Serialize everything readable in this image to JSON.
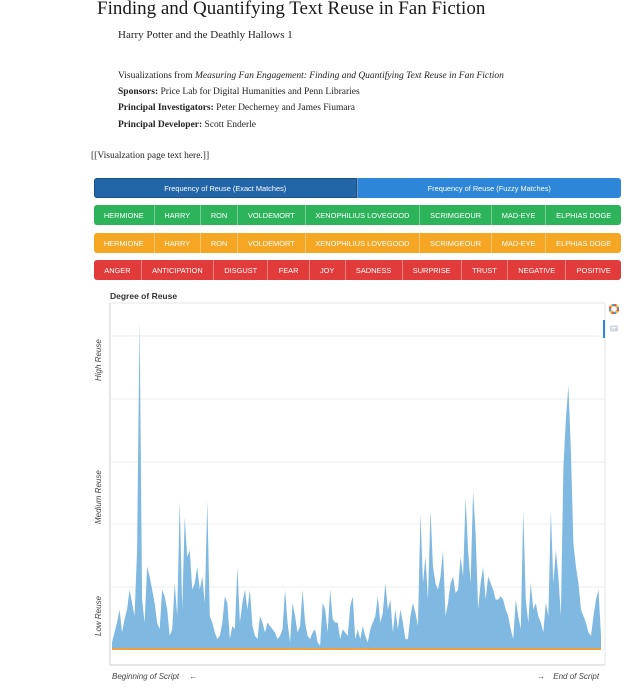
{
  "page": {
    "title": "Finding and Quantifying Text Reuse in Fan Fiction",
    "subtitle": "Harry Potter and the Deathly Hallows 1",
    "viz_prefix": "Visualizations from ",
    "viz_source": "Measuring Fan Engagement: Finding and Quantifying Text Reuse in Fan Fiction",
    "sponsors_label": "Sponsors:",
    "sponsors": " Price Lab for Digital Humanities and Penn Libraries",
    "investigators_label": "Principal Investigators:",
    "investigators": " Peter Decherney and James Fiumara",
    "developer_label": "Principal Developer:",
    "developer": " Scott Enderle",
    "placeholder": "[[Visualzation page text here.]]"
  },
  "tabs": [
    {
      "label": "Frequency of Reuse (Exact Matches)",
      "active": true
    },
    {
      "label": "Frequency of Reuse (Fuzzy Matches)",
      "active": false
    }
  ],
  "character_filters_green": [
    "HERMIONE",
    "HARRY",
    "RON",
    "VOLDEMORT",
    "XENOPHILIUS LOVEGOOD",
    "SCRIMGEOUR",
    "MAD-EYE",
    "ELPHIAS DOGE"
  ],
  "character_filters_orange": [
    "HERMIONE",
    "HARRY",
    "RON",
    "VOLDEMORT",
    "XENOPHILIUS LOVEGOOD",
    "SCRIMGEOUR",
    "MAD-EYE",
    "ELPHIAS DOGE"
  ],
  "emotion_filters": [
    "ANGER",
    "ANTICIPATION",
    "DISGUST",
    "FEAR",
    "JOY",
    "SADNESS",
    "SURPRISE",
    "TRUST",
    "NEGATIVE",
    "POSITIVE"
  ],
  "colors": {
    "tab_active": "#2366a8",
    "tab_inactive": "#2e86d8",
    "green": "#2db35a",
    "orange": "#f5a623",
    "red": "#e23b3b",
    "area_fill": "#7fb8e0",
    "baseline": "#f0a040"
  },
  "icons": [
    "color-wheel-icon",
    "comment-icon"
  ],
  "chart_data": {
    "type": "area",
    "title": "Degree of Reuse",
    "ylabel_levels": [
      "Low Reuse",
      "Medium Reuse",
      "High Reuse"
    ],
    "xlabel_start": "Beginning of Script",
    "xlabel_end": "End of Script",
    "arrow_left": "←",
    "arrow_right": "→",
    "ylim": [
      0,
      100
    ],
    "grid": true,
    "values": [
      2,
      5,
      8,
      12,
      5,
      9,
      12,
      18,
      14,
      10,
      30,
      100,
      15,
      8,
      25,
      22,
      18,
      14,
      8,
      6,
      18,
      16,
      12,
      4,
      6,
      20,
      10,
      45,
      12,
      40,
      28,
      30,
      18,
      20,
      25,
      18,
      22,
      14,
      45,
      10,
      8,
      5,
      3,
      4,
      8,
      16,
      14,
      3,
      7,
      6,
      25,
      8,
      14,
      18,
      12,
      18,
      7,
      4,
      3,
      10,
      8,
      5,
      8,
      7,
      6,
      5,
      3,
      4,
      6,
      18,
      8,
      2,
      14,
      10,
      5,
      7,
      18,
      8,
      4,
      3,
      5,
      6,
      2,
      1,
      14,
      12,
      5,
      18,
      9,
      8,
      8,
      3,
      6,
      5,
      4,
      13,
      16,
      3,
      6,
      3,
      7,
      4,
      2,
      6,
      8,
      10,
      16,
      8,
      11,
      20,
      12,
      15,
      5,
      12,
      6,
      12,
      8,
      3,
      3,
      10,
      14,
      11,
      7,
      41,
      20,
      28,
      15,
      42,
      25,
      20,
      18,
      22,
      30,
      10,
      14,
      20,
      22,
      17,
      18,
      28,
      22,
      46,
      30,
      20,
      48,
      35,
      12,
      20,
      25,
      15,
      22,
      20,
      18,
      15,
      15,
      16,
      15,
      12,
      10,
      6,
      3,
      15,
      10,
      6,
      42,
      15,
      8,
      20,
      12,
      14,
      10,
      8,
      5,
      14,
      10,
      42,
      20,
      30,
      22,
      10,
      55,
      70,
      80,
      60,
      32,
      25,
      20,
      12,
      10,
      8,
      5,
      4,
      10,
      15,
      18,
      4
    ]
  }
}
